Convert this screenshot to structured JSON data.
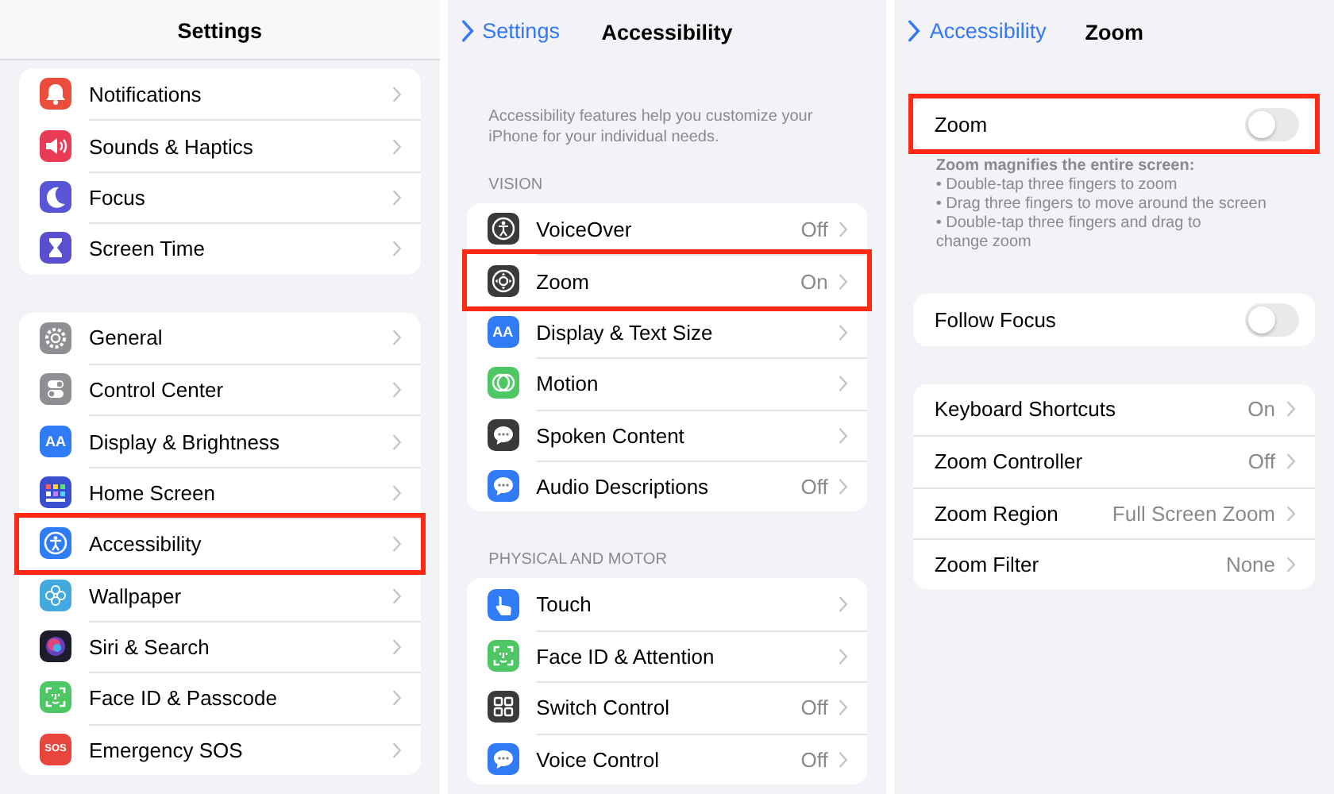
{
  "panels": [
    {
      "title": "Settings",
      "scrolled": true,
      "groups": [
        {
          "items": [
            {
              "kind": "link",
              "label": "Notifications",
              "color": "#eb4d3d",
              "highlighted": false
            },
            {
              "kind": "link",
              "label": "Sounds & Haptics",
              "color": "#e93a56",
              "highlighted": false
            },
            {
              "kind": "link",
              "label": "Focus",
              "color": "#5856d6",
              "highlighted": false
            },
            {
              "kind": "link",
              "label": "Screen Time",
              "color": "#5a4fcf",
              "highlighted": false
            }
          ]
        },
        {
          "items": [
            {
              "kind": "link",
              "label": "General",
              "color": "#8e8e93",
              "highlighted": false
            },
            {
              "kind": "link",
              "label": "Control Center",
              "color": "#8e8e93",
              "highlighted": false
            },
            {
              "kind": "link",
              "label": "Display & Brightness",
              "color": "#2f7cf6",
              "icon_text": "AA",
              "highlighted": false
            },
            {
              "kind": "link",
              "label": "Home Screen",
              "color": "#3a4fd0",
              "highlighted": false
            },
            {
              "kind": "link",
              "label": "Accessibility",
              "color": "#2f7cf6",
              "highlighted": true
            },
            {
              "kind": "link",
              "label": "Wallpaper",
              "color": "#41a9dd",
              "highlighted": false
            },
            {
              "kind": "link",
              "label": "Siri & Search",
              "color": "#1c1c2a",
              "highlighted": false
            },
            {
              "kind": "link",
              "label": "Face ID & Passcode",
              "color": "#4cc764",
              "highlighted": false
            },
            {
              "kind": "link",
              "label": "Emergency SOS",
              "color": "#e8463c",
              "icon_text": "SOS",
              "highlighted": false
            }
          ]
        }
      ]
    },
    {
      "title": "Accessibility",
      "back": "Settings",
      "intro": "Accessibility features help you customize your iPhone for your individual needs.",
      "groups": [
        {
          "header": "VISION",
          "items": [
            {
              "kind": "link",
              "label": "VoiceOver",
              "value": "Off",
              "color": "#3a3a3c",
              "highlighted": false
            },
            {
              "kind": "link",
              "label": "Zoom",
              "value": "On",
              "color": "#3a3a3c",
              "highlighted": true
            },
            {
              "kind": "link",
              "label": "Display & Text Size",
              "color": "#2f7cf6",
              "icon_text": "AA",
              "highlighted": false
            },
            {
              "kind": "link",
              "label": "Motion",
              "color": "#4cc764",
              "highlighted": false
            },
            {
              "kind": "link",
              "label": "Spoken Content",
              "color": "#3a3a3c",
              "highlighted": false
            },
            {
              "kind": "link",
              "label": "Audio Descriptions",
              "value": "Off",
              "color": "#2f7cf6",
              "highlighted": false
            }
          ]
        },
        {
          "header": "PHYSICAL AND MOTOR",
          "items": [
            {
              "kind": "link",
              "label": "Touch",
              "color": "#2f7cf6",
              "highlighted": false
            },
            {
              "kind": "link",
              "label": "Face ID & Attention",
              "color": "#4cc764",
              "highlighted": false
            },
            {
              "kind": "link",
              "label": "Switch Control",
              "value": "Off",
              "color": "#3a3a3c",
              "highlighted": false
            },
            {
              "kind": "link",
              "label": "Voice Control",
              "value": "Off",
              "color": "#2f7cf6",
              "highlighted": false
            }
          ]
        }
      ]
    },
    {
      "title": "Zoom",
      "back": "Accessibility",
      "groups": [
        {
          "items": [
            {
              "kind": "toggle",
              "label": "Zoom",
              "on": false,
              "highlighted": true
            }
          ],
          "footer": {
            "title": "Zoom magnifies the entire screen:",
            "bullets": [
              "• Double-tap three fingers to zoom",
              "• Drag three fingers to move around the screen",
              "• Double-tap three fingers and drag to\nchange zoom"
            ]
          }
        },
        {
          "items": [
            {
              "kind": "toggle",
              "label": "Follow Focus",
              "on": false,
              "highlighted": false
            }
          ]
        },
        {
          "items": [
            {
              "kind": "link",
              "label": "Keyboard Shortcuts",
              "value": "On",
              "highlighted": false
            },
            {
              "kind": "link",
              "label": "Zoom Controller",
              "value": "Off",
              "highlighted": false
            },
            {
              "kind": "link",
              "label": "Zoom Region",
              "value": "Full Screen Zoom",
              "highlighted": false
            },
            {
              "kind": "link",
              "label": "Zoom Filter",
              "value": "None",
              "highlighted": false
            }
          ]
        }
      ]
    }
  ]
}
